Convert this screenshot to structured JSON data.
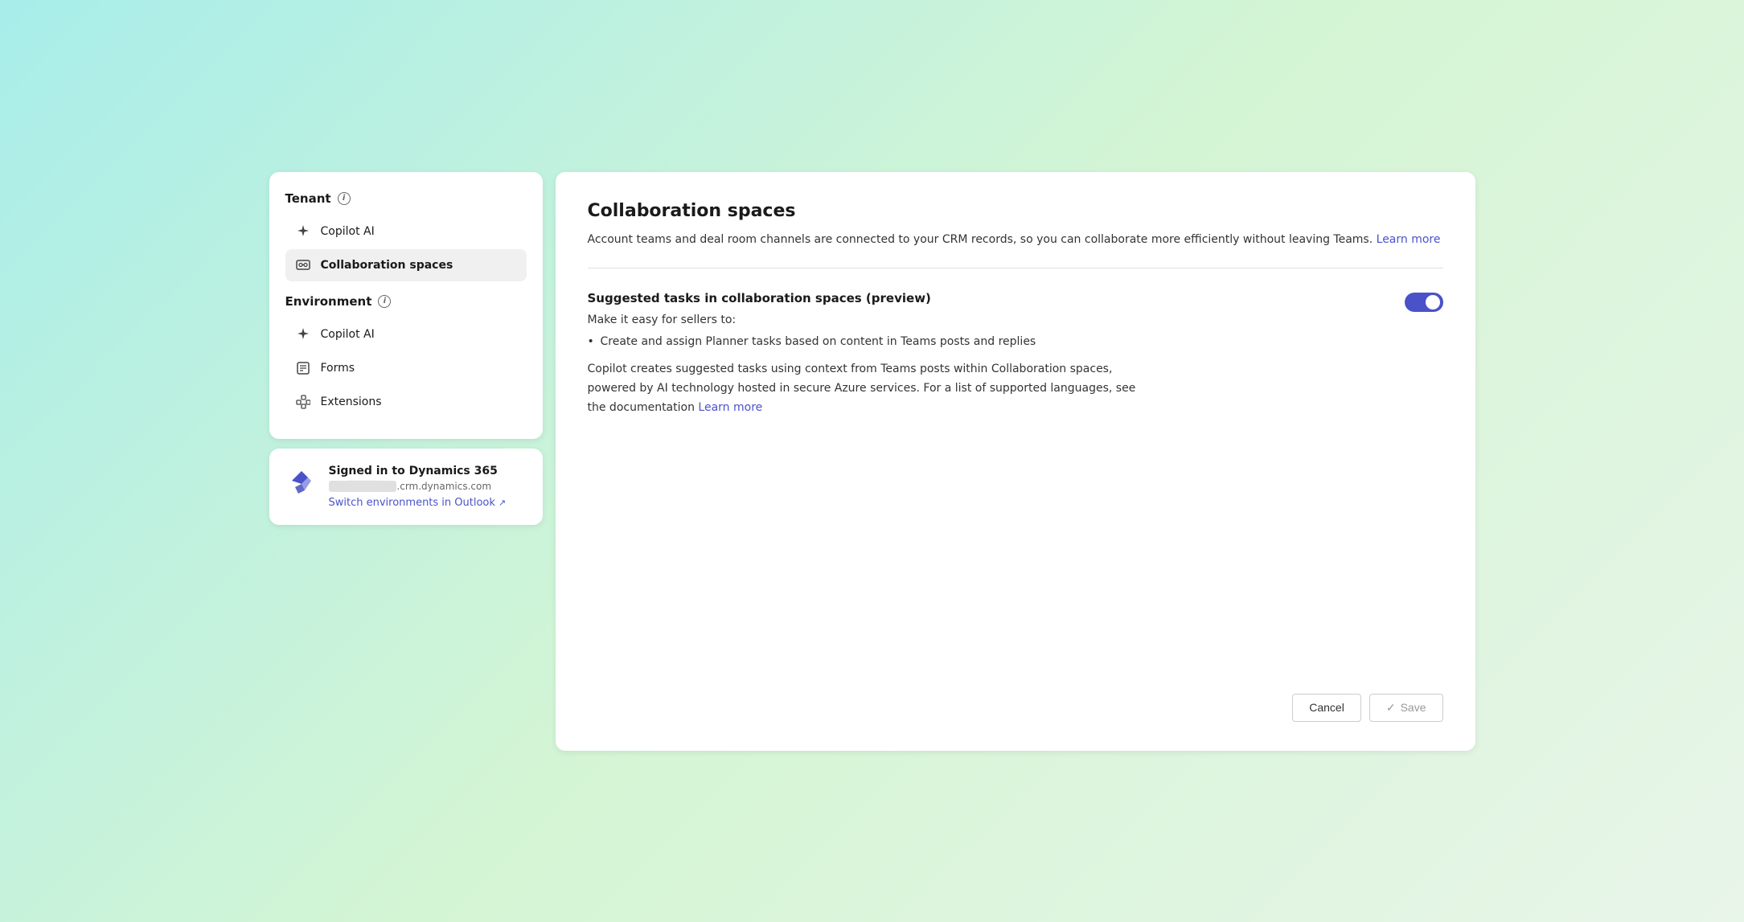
{
  "sidebar": {
    "tenant_section": "Tenant",
    "tenant_items": [
      {
        "id": "copilot-ai-tenant",
        "label": "Copilot AI",
        "icon": "sparkle"
      }
    ],
    "active_item": "collaboration-spaces",
    "active_label": "Collaboration spaces",
    "environment_section": "Environment",
    "environment_items": [
      {
        "id": "copilot-ai-env",
        "label": "Copilot AI",
        "icon": "sparkle"
      },
      {
        "id": "forms",
        "label": "Forms",
        "icon": "form"
      },
      {
        "id": "extensions",
        "label": "Extensions",
        "icon": "extension"
      }
    ]
  },
  "signin": {
    "title": "Signed in to Dynamics 365",
    "url": "          .crm.dynamics.com",
    "switch_link": "Switch environments in Outlook"
  },
  "main": {
    "page_title": "Collaboration spaces",
    "page_description": "Account teams and deal room channels are connected to your CRM records, so you can collaborate more efficiently without leaving Teams.",
    "learn_more_text": "Learn more",
    "feature": {
      "title": "Suggested tasks in collaboration spaces (preview)",
      "subtitle": "Make it easy for sellers to:",
      "list_item": "Create and assign Planner tasks based on content in Teams posts and replies",
      "description": "Copilot creates suggested tasks using context from Teams posts within Collaboration spaces, powered by AI technology hosted in secure Azure services. For a list of supported languages, see the documentation",
      "learn_more_text": "Learn more",
      "toggle_enabled": true
    }
  },
  "footer": {
    "cancel_label": "Cancel",
    "save_label": "Save"
  }
}
